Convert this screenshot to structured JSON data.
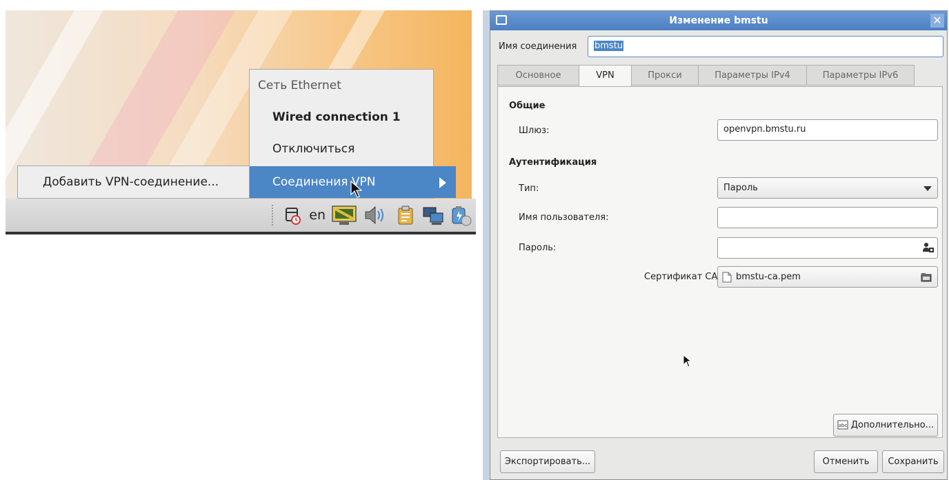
{
  "network_menu": {
    "header": "Сеть Ethernet",
    "items": [
      {
        "label": "Wired connection 1"
      },
      {
        "label": "Отключиться"
      },
      {
        "label": "Соединения VPN"
      }
    ],
    "submenu_item": "Добавить VPN-соединение..."
  },
  "tray": {
    "keyboard_layout": "en"
  },
  "dialog": {
    "title": "Изменение bmstu",
    "connection_name_label": "Имя соединения",
    "connection_name_value": "bmstu",
    "tabs": [
      "Основное",
      "VPN",
      "Прокси",
      "Параметры IPv4",
      "Параметры IPv6"
    ],
    "active_tab": "VPN",
    "general_section": "Общие",
    "gateway_label": "Шлюз:",
    "gateway_value": "openvpn.bmstu.ru",
    "auth_section": "Аутентификация",
    "type_label": "Тип:",
    "type_value": "Пароль",
    "username_label": "Имя пользователя:",
    "username_value": "",
    "password_label": "Пароль:",
    "password_value": "",
    "ca_label": "Сертификат CA",
    "ca_value": "bmstu-ca.pem",
    "advanced_button": "Дополнительно...",
    "export_button": "Экспортировать...",
    "cancel_button": "Отменить",
    "save_button": "Сохранить"
  },
  "colors": {
    "accent": "#4b86c6",
    "titlebar": "#5a8ccc"
  }
}
